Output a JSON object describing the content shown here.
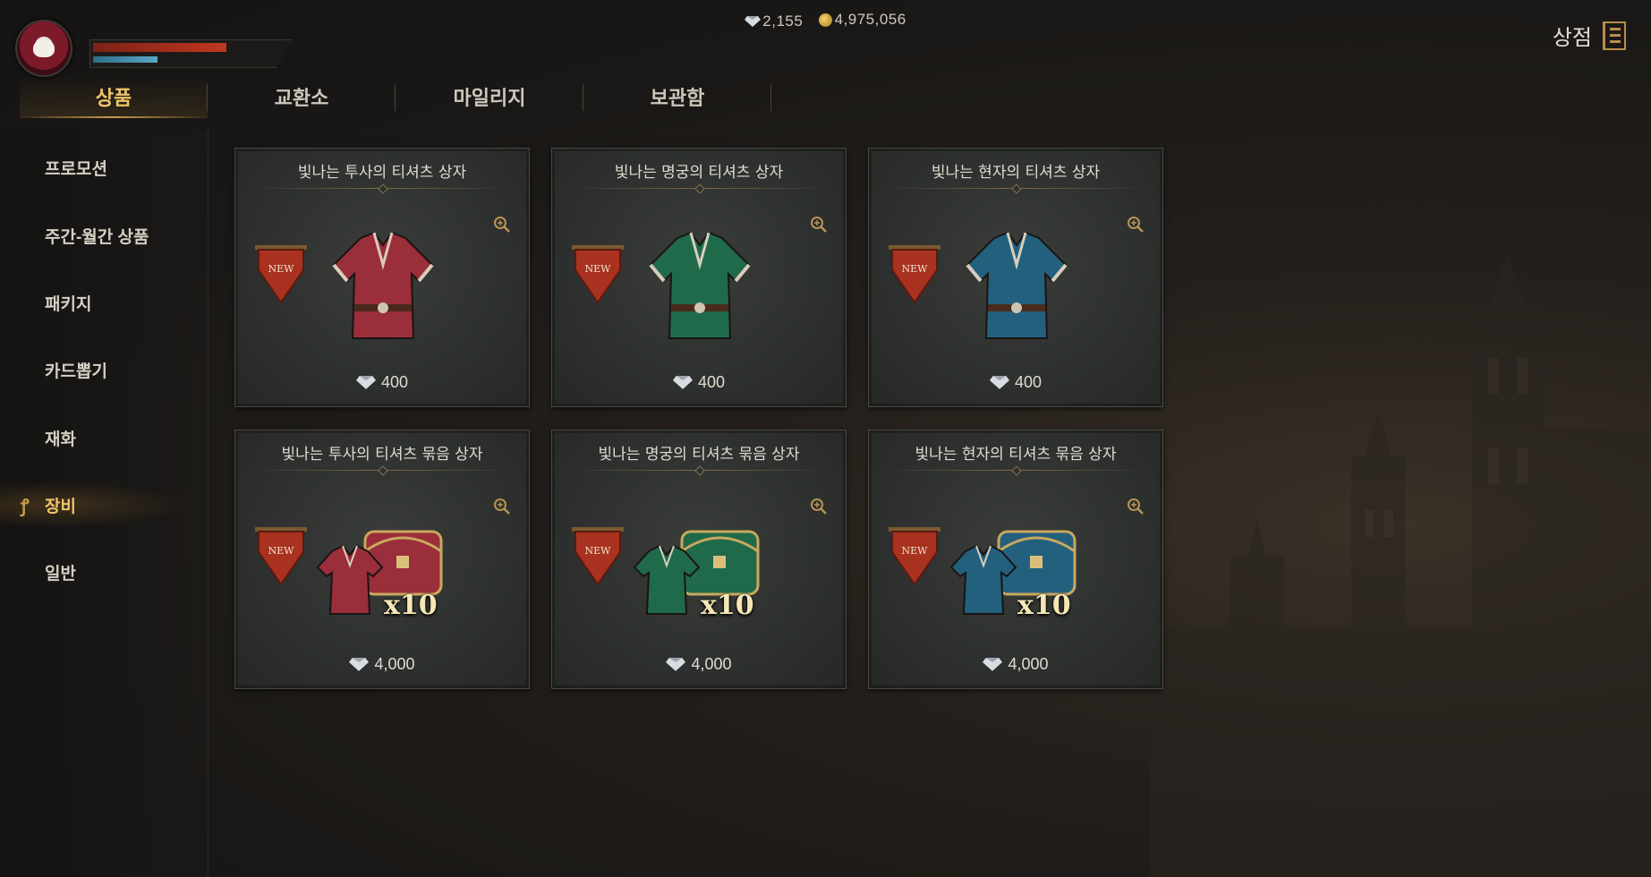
{
  "currency": {
    "gems": "2,155",
    "gold": "4,975,056"
  },
  "shop": {
    "title": "상점"
  },
  "tabs": [
    {
      "label": "상품",
      "active": true
    },
    {
      "label": "교환소",
      "active": false
    },
    {
      "label": "마일리지",
      "active": false
    },
    {
      "label": "보관함",
      "active": false
    }
  ],
  "sidebar": [
    {
      "label": "프로모션",
      "active": false
    },
    {
      "label": "주간-월간 상품",
      "active": false
    },
    {
      "label": "패키지",
      "active": false
    },
    {
      "label": "카드뽑기",
      "active": false
    },
    {
      "label": "재화",
      "active": false
    },
    {
      "label": "장비",
      "active": true
    },
    {
      "label": "일반",
      "active": false
    }
  ],
  "products": [
    {
      "title": "빛나는 투사의 티셔츠 상자",
      "price": "400",
      "badge": "NEW",
      "color": "#9a2e3a",
      "bundle": false
    },
    {
      "title": "빛나는 명궁의 티셔츠 상자",
      "price": "400",
      "badge": "NEW",
      "color": "#1f6a4a",
      "bundle": false
    },
    {
      "title": "빛나는 현자의 티셔츠 상자",
      "price": "400",
      "badge": "NEW",
      "color": "#23607e",
      "bundle": false
    },
    {
      "title": "빛나는 투사의 티셔츠 묶음 상자",
      "price": "4,000",
      "badge": "NEW",
      "color": "#9a2e3a",
      "bundle": true,
      "qty": "x10"
    },
    {
      "title": "빛나는 명궁의 티셔츠 묶음 상자",
      "price": "4,000",
      "badge": "NEW",
      "color": "#1f6a4a",
      "bundle": true,
      "qty": "x10"
    },
    {
      "title": "빛나는 현자의 티셔츠 묶음 상자",
      "price": "4,000",
      "badge": "NEW",
      "color": "#23607e",
      "bundle": true,
      "qty": "x10"
    }
  ],
  "colors": {
    "accent": "#f0c56a",
    "hp": "#c1381f",
    "mp": "#5aa7c8"
  },
  "player": {
    "hp_fraction": 0.83,
    "mp_fraction": 0.4
  }
}
